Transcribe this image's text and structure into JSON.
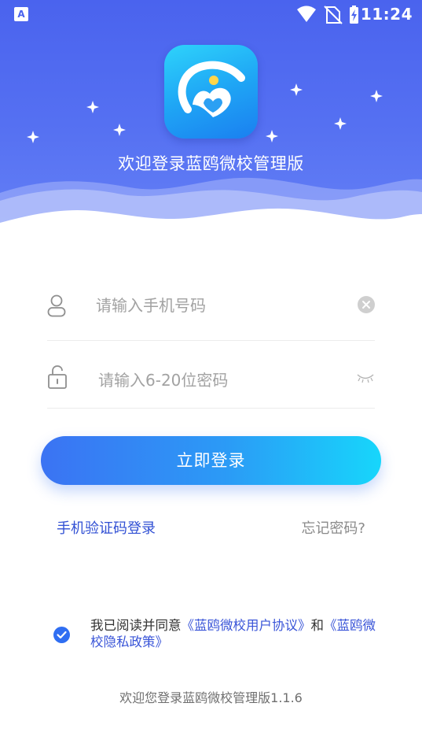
{
  "status_bar": {
    "app_badge": "A",
    "time": "11:24",
    "icons": [
      "wifi-icon",
      "no-sim-icon",
      "battery-charging-icon"
    ]
  },
  "header": {
    "logo": "lan-ou-logo-icon",
    "welcome": "欢迎登录蓝鸥微校管理版"
  },
  "form": {
    "phone": {
      "placeholder": "请输入手机号码",
      "icon": "user-icon",
      "action_icon": "clear-icon"
    },
    "password": {
      "placeholder": "请输入6-20位密码",
      "icon": "lock-icon",
      "action_icon": "eye-closed-icon"
    },
    "login_label": "立即登录",
    "sms_login_label": "手机验证码登录",
    "forgot_label": "忘记密码?"
  },
  "agreement": {
    "checked": true,
    "prefix": "我已阅读并同意",
    "user_agreement": "《蓝鸥微校用户协议》",
    "conjunction": "和",
    "privacy_policy": "《蓝鸥微校隐私政策》"
  },
  "footer": {
    "version_text": "欢迎您登录蓝鸥微校管理版1.1.6"
  },
  "colors": {
    "primary": "#4a63ee",
    "link": "#3150d4",
    "button_start": "#3b73f3",
    "button_end": "#17d6fb"
  }
}
